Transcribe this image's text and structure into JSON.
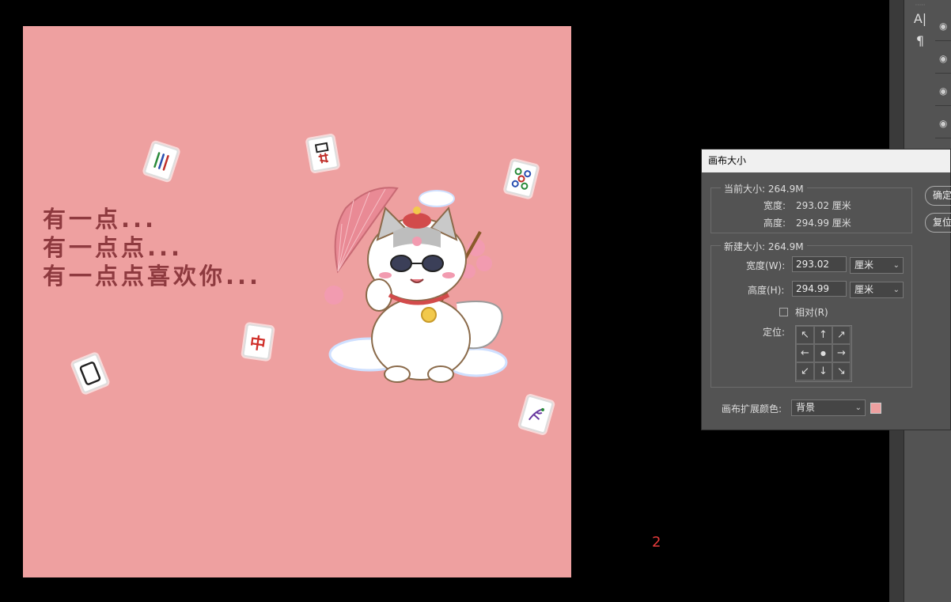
{
  "canvas": {
    "background": "#EEA0A0",
    "headline_lines": [
      "有一点...",
      "有一点点...",
      "有一点点喜欢你..."
    ],
    "text_color": "#8E3A3F",
    "tiles": {
      "character_tile": "中"
    }
  },
  "page_number": "2",
  "toolbar": {
    "type_icon": "A|",
    "paragraph_icon": "¶"
  },
  "dialog": {
    "title": "画布大小",
    "current_size": {
      "label": "当前大小: 264.9M",
      "width_label": "宽度:",
      "width_value": "293.02 厘米",
      "height_label": "高度:",
      "height_value": "294.99 厘米"
    },
    "new_size": {
      "label": "新建大小: 264.9M",
      "width_label": "宽度(W):",
      "width_value": "293.02",
      "width_unit": "厘米",
      "height_label": "高度(H):",
      "height_value": "294.99",
      "height_unit": "厘米",
      "relative_label": "相对(R)",
      "anchor_label": "定位:",
      "anchor_arrows": [
        "↖",
        "↑",
        "↗",
        "←",
        "●",
        "→",
        "↙",
        "↓",
        "↘"
      ]
    },
    "extension_color_label": "画布扩展颜色:",
    "extension_color_value": "背景",
    "extension_swatch": "#EEA0A0",
    "ok_button": "确定",
    "reset_button": "复位"
  }
}
